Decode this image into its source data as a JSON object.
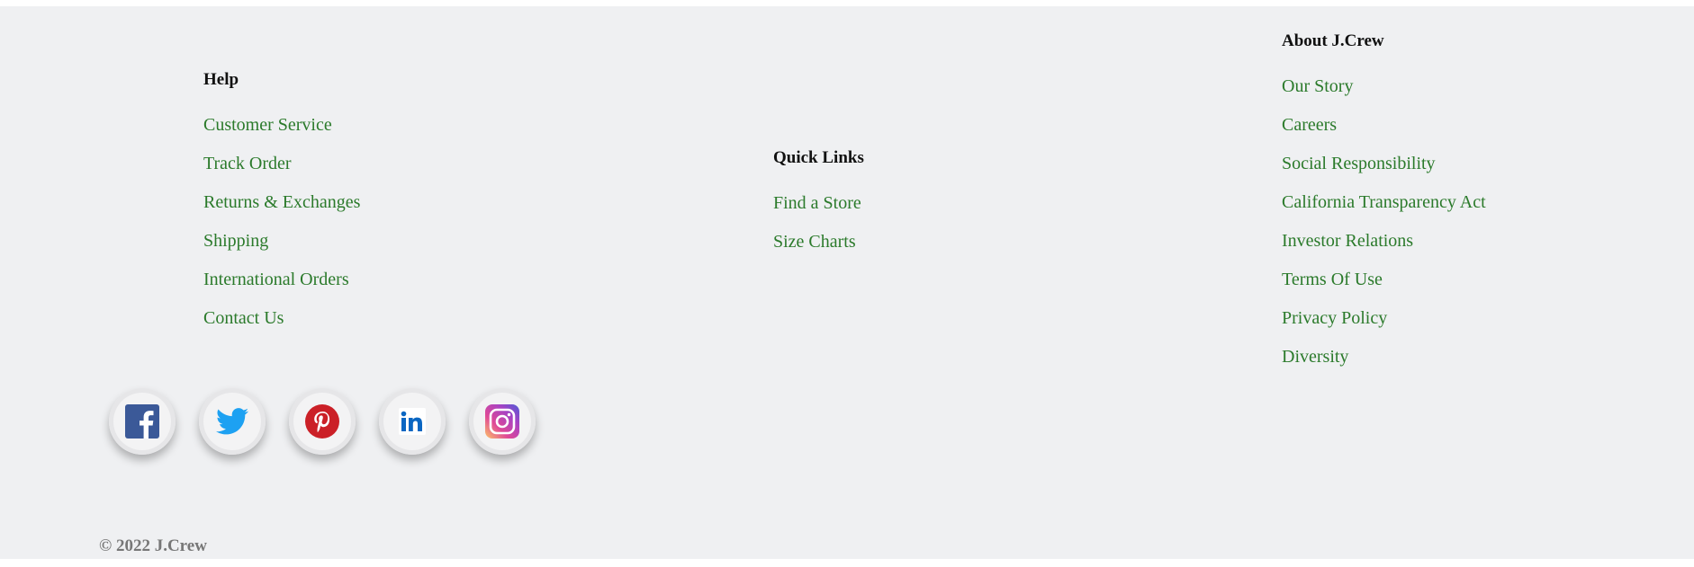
{
  "help": {
    "heading": "Help",
    "links": [
      "Customer Service",
      "Track Order",
      "Returns & Exchanges",
      "Shipping",
      "International Orders",
      "Contact Us"
    ]
  },
  "quick_links": {
    "heading": "Quick Links",
    "links": [
      "Find a Store",
      "Size Charts"
    ]
  },
  "about": {
    "heading": "About J.Crew",
    "links": [
      "Our Story",
      "Careers",
      "Social Responsibility",
      "California Transparency Act",
      "Investor Relations",
      "Terms Of Use",
      "Privacy Policy",
      "Diversity"
    ]
  },
  "social": {
    "icons": [
      "facebook-icon",
      "twitter-icon",
      "pinterest-icon",
      "linkedin-icon",
      "instagram-icon"
    ],
    "colors": {
      "facebook": "#3b5998",
      "twitter": "#1da1f2",
      "pinterest": "#cb2027",
      "linkedin": "#0a66c2",
      "instagram": "#c13584"
    }
  },
  "copyright": "© 2022 J.Crew",
  "colors": {
    "link": "#2b7a2b",
    "background": "#eff0f2"
  }
}
